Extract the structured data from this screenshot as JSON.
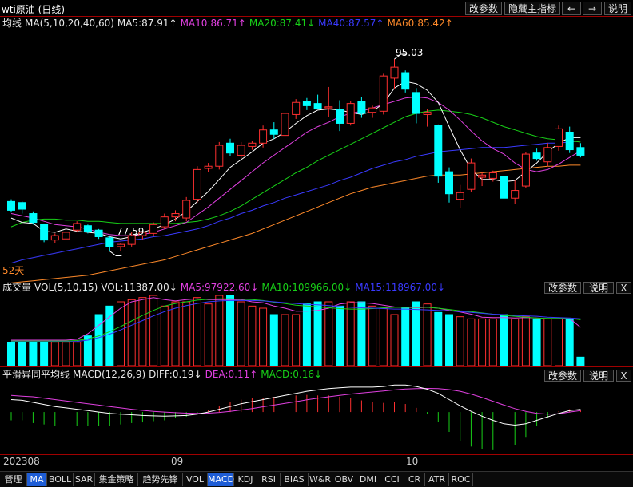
{
  "header": {
    "title": "wti原油 (日线)",
    "buttons": [
      "改参数",
      "隐藏主指标"
    ],
    "nav_prev": "←",
    "nav_next": "→",
    "help": "说明"
  },
  "main_legend": {
    "label": "均线",
    "params": "MA(5,10,20,40,60)",
    "ma5": "MA5:87.91↑",
    "ma10": "MA10:86.71↑",
    "ma20": "MA20:87.41↓",
    "ma40": "MA40:87.57↑",
    "ma60": "MA60:85.42↑"
  },
  "volume_legend": {
    "label": "成交量",
    "params": "VOL(5,10,15)",
    "vol": "VOL:11387.00↓",
    "ma5": "MA5:97922.60↓",
    "ma10": "MA10:109966.00↓",
    "ma15": "MA15:118967.00↓"
  },
  "macd_legend": {
    "label": "平滑异同平均线",
    "params": "MACD(12,26,9)",
    "diff": "DIFF:0.19↓",
    "dea": "DEA:0.11↑",
    "macd": "MACD:0.16↓"
  },
  "panel_buttons": {
    "params": "改参数",
    "help": "说明",
    "close": "X"
  },
  "annotations": {
    "high": "95.03",
    "low": "77.59",
    "days": "52天"
  },
  "x_ticks": [
    "202308",
    "09",
    "10"
  ],
  "tabs": [
    "管理",
    "MA",
    "BOLL",
    "SAR",
    "集金策略",
    "趋势先锋",
    "VOL",
    "MACD",
    "KDJ",
    "RSI",
    "BIAS",
    "W&R",
    "OBV",
    "DMI",
    "CCI",
    "CR",
    "ATR",
    "ROC"
  ],
  "active_tabs": [
    "MA",
    "MACD"
  ],
  "colors": {
    "up": "#ff3030",
    "down": "#00ffff",
    "ma5": "#ffffff",
    "ma10": "#e040e0",
    "ma20": "#18d018",
    "ma40": "#3a3aff",
    "ma60": "#ff8a2a"
  },
  "chart_data": {
    "type": "candlestick",
    "price_range": [
      75.6,
      97.5
    ],
    "ohlc": [
      [
        82.1,
        82.3,
        81.1,
        81.3
      ],
      [
        82.0,
        82.1,
        81.0,
        81.4
      ],
      [
        81.0,
        81.2,
        80.0,
        80.2
      ],
      [
        80.0,
        80.1,
        78.4,
        78.6
      ],
      [
        78.6,
        79.2,
        78.3,
        79.0
      ],
      [
        78.7,
        79.5,
        78.5,
        79.3
      ],
      [
        79.5,
        80.3,
        79.3,
        80.1
      ],
      [
        79.9,
        80.0,
        79.2,
        79.4
      ],
      [
        79.5,
        79.6,
        78.7,
        78.9
      ],
      [
        78.8,
        79.0,
        77.59,
        78.0
      ],
      [
        78.0,
        78.3,
        77.6,
        78.2
      ],
      [
        78.2,
        79.3,
        78.0,
        79.0
      ],
      [
        79.0,
        79.5,
        78.6,
        79.3
      ],
      [
        79.2,
        80.2,
        79.0,
        80.0
      ],
      [
        79.8,
        81.0,
        79.6,
        80.7
      ],
      [
        80.7,
        81.3,
        80.3,
        81.0
      ],
      [
        80.6,
        82.5,
        80.3,
        82.2
      ],
      [
        82.3,
        85.3,
        82.0,
        85.0
      ],
      [
        85.1,
        85.6,
        84.8,
        85.3
      ],
      [
        85.3,
        87.5,
        85.0,
        87.2
      ],
      [
        87.4,
        87.8,
        86.2,
        86.5
      ],
      [
        86.3,
        87.5,
        86.0,
        87.2
      ],
      [
        87.1,
        87.6,
        86.8,
        87.4
      ],
      [
        87.4,
        89.0,
        87.0,
        88.6
      ],
      [
        88.6,
        89.3,
        87.8,
        88.2
      ],
      [
        88.1,
        90.4,
        87.9,
        90.1
      ],
      [
        90.0,
        91.4,
        89.6,
        91.1
      ],
      [
        91.2,
        91.5,
        90.4,
        90.8
      ],
      [
        91.0,
        91.8,
        90.5,
        90.5
      ],
      [
        90.6,
        92.5,
        89.8,
        90.7
      ],
      [
        90.5,
        91.3,
        88.5,
        89.2
      ],
      [
        89.2,
        91.2,
        89.0,
        91.0
      ],
      [
        91.2,
        91.6,
        89.7,
        90.1
      ],
      [
        90.2,
        90.8,
        89.7,
        90.6
      ],
      [
        90.3,
        93.7,
        90.0,
        93.5
      ],
      [
        93.3,
        95.03,
        92.3,
        94.3
      ],
      [
        93.8,
        94.0,
        92.0,
        92.3
      ],
      [
        92.0,
        92.4,
        89.2,
        90.1
      ],
      [
        90.0,
        90.5,
        88.9,
        90.2
      ],
      [
        89.0,
        89.1,
        83.8,
        84.4
      ],
      [
        84.8,
        85.2,
        82.0,
        82.8
      ],
      [
        82.3,
        83.6,
        81.5,
        82.9
      ],
      [
        83.2,
        86.0,
        83.0,
        85.6
      ],
      [
        84.3,
        84.8,
        83.5,
        84.5
      ],
      [
        84.2,
        84.9,
        83.9,
        84.7
      ],
      [
        84.4,
        84.8,
        81.8,
        82.4
      ],
      [
        82.4,
        84.0,
        81.9,
        83.1
      ],
      [
        83.5,
        86.6,
        83.3,
        86.4
      ],
      [
        86.5,
        86.9,
        85.8,
        86.0
      ],
      [
        85.7,
        87.4,
        85.3,
        87.0
      ],
      [
        87.1,
        89.0,
        86.7,
        88.7
      ],
      [
        88.4,
        88.9,
        86.5,
        86.8
      ],
      [
        87.0,
        87.4,
        86.1,
        86.3
      ]
    ],
    "ma5": [
      80.6,
      80.2,
      80.1,
      79.4,
      79.3,
      79.6,
      79.4,
      79.3,
      79.2,
      78.9,
      78.7,
      78.9,
      79.3,
      79.6,
      80.0,
      80.5,
      81.2,
      82.1,
      83.0,
      84.1,
      85.2,
      85.9,
      86.6,
      87.4,
      87.8,
      88.4,
      89.2,
      89.9,
      90.4,
      90.5,
      90.4,
      90.2,
      90.0,
      90.3,
      91.0,
      92.4,
      93.0,
      92.8,
      92.2,
      91.1,
      88.9,
      86.8,
      85.0,
      84.1,
      84.1,
      83.9,
      84.0,
      84.8,
      85.6,
      86.6,
      87.4,
      87.9,
      87.9
    ],
    "ma10": [
      81.0,
      80.8,
      80.6,
      80.3,
      80.0,
      79.9,
      79.8,
      79.6,
      79.3,
      79.1,
      79.0,
      79.0,
      79.1,
      79.3,
      79.6,
      79.9,
      80.2,
      80.9,
      81.6,
      82.4,
      83.2,
      84.0,
      84.8,
      85.6,
      86.3,
      87.0,
      87.7,
      88.4,
      88.9,
      89.3,
      89.8,
      90.1,
      90.3,
      90.6,
      90.9,
      91.2,
      91.5,
      91.6,
      91.5,
      91.1,
      90.4,
      89.5,
      88.5,
      87.6,
      86.9,
      86.4,
      85.6,
      85.0,
      84.8,
      85.0,
      85.5,
      86.1,
      86.7
    ],
    "ma20": [
      79.8,
      80.2,
      80.4,
      80.5,
      80.5,
      80.4,
      80.4,
      80.3,
      80.3,
      80.2,
      80.1,
      80.1,
      80.1,
      80.1,
      80.1,
      80.1,
      80.2,
      80.3,
      80.5,
      80.8,
      81.2,
      81.7,
      82.3,
      82.9,
      83.5,
      84.1,
      84.7,
      85.2,
      85.8,
      86.3,
      86.8,
      87.3,
      87.8,
      88.3,
      88.8,
      89.3,
      89.8,
      90.1,
      90.3,
      90.4,
      90.3,
      90.2,
      90.0,
      89.7,
      89.3,
      88.9,
      88.6,
      88.3,
      88.0,
      87.8,
      87.7,
      87.6,
      87.5
    ],
    "ma40": [
      76.5,
      76.8,
      77.0,
      77.2,
      77.4,
      77.6,
      77.8,
      78.0,
      78.2,
      78.4,
      78.5,
      78.6,
      78.7,
      78.9,
      79.0,
      79.2,
      79.4,
      79.6,
      79.9,
      80.3,
      80.6,
      81.0,
      81.3,
      81.7,
      82.0,
      82.4,
      82.7,
      83.0,
      83.3,
      83.6,
      84.0,
      84.3,
      84.7,
      85.1,
      85.4,
      85.7,
      85.9,
      86.2,
      86.4,
      86.6,
      86.7,
      86.8,
      86.9,
      87.0,
      87.0,
      87.0,
      87.1,
      87.2,
      87.3,
      87.4,
      87.4,
      87.5,
      87.6
    ],
    "ma60": [
      74.7,
      74.8,
      74.9,
      75.0,
      75.1,
      75.2,
      75.3,
      75.4,
      75.6,
      75.8,
      76.0,
      76.2,
      76.4,
      76.6,
      76.8,
      77.1,
      77.4,
      77.7,
      78.0,
      78.3,
      78.6,
      78.9,
      79.2,
      79.6,
      80.0,
      80.4,
      80.8,
      81.2,
      81.6,
      82.0,
      82.4,
      82.8,
      83.1,
      83.4,
      83.6,
      83.8,
      84.0,
      84.2,
      84.4,
      84.5,
      84.5,
      84.5,
      84.6,
      84.7,
      84.8,
      84.9,
      85.0,
      85.1,
      85.2,
      85.3,
      85.3,
      85.4,
      85.4
    ],
    "volume": [
      55,
      55,
      55,
      55,
      55,
      55,
      55,
      70,
      120,
      140,
      150,
      155,
      160,
      165,
      140,
      150,
      150,
      160,
      145,
      165,
      165,
      150,
      140,
      135,
      120,
      120,
      120,
      145,
      150,
      150,
      140,
      150,
      150,
      140,
      135,
      120,
      135,
      150,
      145,
      125,
      120,
      115,
      110,
      110,
      110,
      120,
      110,
      115,
      110,
      110,
      110,
      110,
      20
    ],
    "vol_ma5": [
      60,
      60,
      60,
      60,
      60,
      60,
      62,
      75,
      95,
      115,
      135,
      150,
      155,
      160,
      155,
      152,
      155,
      157,
      155,
      155,
      155,
      155,
      150,
      148,
      140,
      135,
      128,
      128,
      130,
      135,
      145,
      148,
      148,
      146,
      142,
      138,
      137,
      136,
      137,
      135,
      130,
      126,
      121,
      114,
      113,
      113,
      112,
      113,
      112,
      110,
      110,
      111,
      90
    ],
    "vol_ma10": [
      58,
      58,
      58,
      58,
      58,
      58,
      59,
      63,
      70,
      80,
      92,
      105,
      118,
      130,
      140,
      146,
      150,
      154,
      156,
      157,
      157,
      156,
      155,
      153,
      149,
      146,
      142,
      140,
      138,
      136,
      134,
      133,
      133,
      134,
      136,
      137,
      137,
      137,
      137,
      135,
      132,
      129,
      127,
      124,
      121,
      118,
      116,
      114,
      112,
      111,
      111,
      111,
      108
    ],
    "vol_ma15": [
      56,
      56,
      56,
      56,
      56,
      56,
      57,
      60,
      66,
      74,
      84,
      95,
      106,
      117,
      127,
      135,
      141,
      146,
      150,
      152,
      153,
      153,
      153,
      152,
      150,
      148,
      146,
      144,
      143,
      141,
      139,
      137,
      136,
      135,
      134,
      133,
      133,
      132,
      131,
      130,
      129,
      127,
      125,
      123,
      121,
      120,
      118,
      117,
      116,
      114,
      113,
      112,
      110
    ],
    "macd_diff": [
      0.9,
      0.85,
      0.7,
      0.55,
      0.4,
      0.3,
      0.2,
      0.1,
      0.0,
      -0.1,
      -0.15,
      -0.2,
      -0.25,
      -0.28,
      -0.3,
      -0.28,
      -0.25,
      -0.15,
      0.0,
      0.2,
      0.4,
      0.6,
      0.75,
      0.9,
      1.05,
      1.2,
      1.35,
      1.5,
      1.6,
      1.7,
      1.75,
      1.8,
      1.8,
      1.8,
      1.85,
      1.95,
      1.95,
      1.85,
      1.65,
      1.35,
      0.9,
      0.45,
      0.05,
      -0.3,
      -0.6,
      -0.85,
      -0.95,
      -0.85,
      -0.6,
      -0.35,
      -0.1,
      0.1,
      0.19
    ],
    "macd_dea": [
      1.2,
      1.15,
      1.1,
      1.0,
      0.9,
      0.8,
      0.7,
      0.6,
      0.5,
      0.4,
      0.3,
      0.2,
      0.12,
      0.05,
      0.0,
      -0.05,
      -0.08,
      -0.1,
      -0.08,
      -0.03,
      0.05,
      0.15,
      0.25,
      0.38,
      0.5,
      0.62,
      0.75,
      0.88,
      1.0,
      1.1,
      1.2,
      1.3,
      1.38,
      1.45,
      1.52,
      1.6,
      1.66,
      1.7,
      1.71,
      1.7,
      1.62,
      1.5,
      1.3,
      1.05,
      0.78,
      0.5,
      0.25,
      0.05,
      -0.1,
      -0.15,
      -0.12,
      0.0,
      0.11
    ],
    "macd_hist": [
      -0.6,
      -0.6,
      -0.8,
      -0.9,
      -1.0,
      -1.0,
      -1.0,
      -1.0,
      -1.0,
      -1.0,
      -0.9,
      -0.8,
      -0.75,
      -0.66,
      -0.6,
      -0.46,
      -0.34,
      -0.1,
      0.16,
      0.46,
      0.7,
      0.9,
      1.0,
      1.04,
      1.1,
      1.16,
      1.2,
      1.24,
      1.2,
      1.2,
      1.1,
      1.0,
      0.84,
      0.7,
      0.66,
      0.7,
      0.58,
      0.3,
      -0.12,
      -0.7,
      -1.44,
      -2.1,
      -2.5,
      -2.7,
      -2.76,
      -2.7,
      -2.4,
      -1.8,
      -1.0,
      -0.4,
      0.04,
      0.2,
      0.16
    ],
    "macd_range": [
      -3.0,
      2.2
    ]
  }
}
